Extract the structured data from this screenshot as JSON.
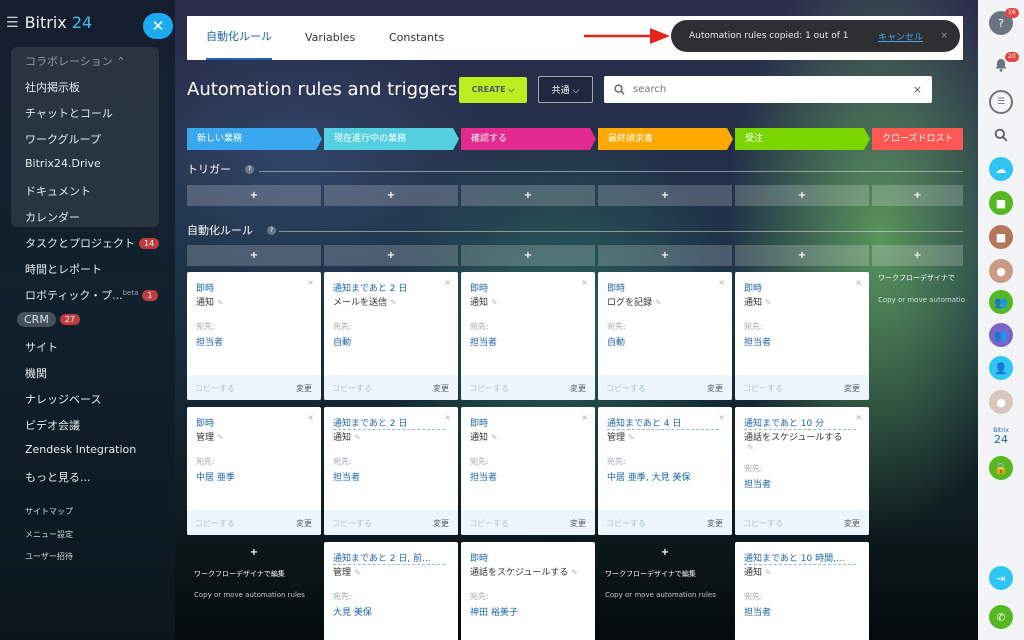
{
  "app": {
    "brand_a": "Bitrix",
    "brand_b": "24"
  },
  "left_nav": {
    "collab_header": "コラボレーション ⌃",
    "items": [
      "社内掲示板",
      "チャットとコール",
      "ワークグループ",
      "Bitrix24.Drive",
      "ドキュメント",
      "カレンダー",
      "タスクとプロジェクト",
      "時間とレポート",
      "ロボティック・プ...",
      "CRM",
      "サイト",
      "機関",
      "ナレッジベース",
      "ビデオ会議",
      "Zendesk Integration",
      "もっと見る..."
    ],
    "badges": {
      "tasks": "14",
      "robotic": "1",
      "crm": "27"
    },
    "beta": "beta",
    "footer": [
      "サイトマップ",
      "メニュー設定",
      "ユーザー招待"
    ]
  },
  "tabs": [
    "自動化ルール",
    "Variables",
    "Constants"
  ],
  "toast": {
    "message": "Automation rules copied: 1 out of 1",
    "cancel": "キャンセル",
    "close": "×"
  },
  "page_title": "Automation rules and triggers",
  "create_label": "CREATE ⌵",
  "common_label": "共通 ⌵",
  "search": {
    "placeholder": "search",
    "clear": "×"
  },
  "stages": [
    {
      "label": "新しい業務",
      "color": "#39a8ef"
    },
    {
      "label": "現在進行中の業務",
      "color": "#55d0e0"
    },
    {
      "label": "確認する",
      "color": "#e32a8e"
    },
    {
      "label": "最終請求書",
      "color": "#ffa900"
    },
    {
      "label": "受注",
      "color": "#7bd500"
    },
    {
      "label": "クローズドロスト",
      "color": "#ff5752"
    }
  ],
  "triggers_header": "トリガー",
  "rules_header": "自動化ルール",
  "help_mark": "?",
  "add_symbol": "+",
  "card_labels": {
    "recipient": "宛先:",
    "copy": "コピーする",
    "change": "変更",
    "close": "×",
    "pencil": "✎"
  },
  "cards": [
    {
      "when": "即時",
      "action": "通知",
      "recipient": "担当者"
    },
    {
      "when": "通知まであと 2 日",
      "action": "メールを送信",
      "recipient": "自動"
    },
    {
      "when": "即時",
      "action": "通知",
      "recipient": "担当者"
    },
    {
      "when": "即時",
      "action": "ログを記録",
      "recipient": "自動"
    },
    {
      "when": "即時",
      "action": "通知",
      "recipient": "担当者"
    },
    {
      "when": "即時",
      "action": "管理",
      "recipient": "中居 亜季"
    },
    {
      "when": "通知まであと 2 日",
      "action": "通知",
      "recipient": "担当者"
    },
    {
      "when": "即時",
      "action": "通知",
      "recipient": "担当者"
    },
    {
      "when": "通知まであと 4 日",
      "action": "管理",
      "recipient": "中居 亜季, 大見 美保"
    },
    {
      "when": "通知まであと 10 分",
      "action": "通話をスケジュールする",
      "recipient": "担当者"
    },
    {
      "when": "通知まであと 2 日, 前...",
      "action": "管理",
      "recipient": "大見 美保"
    },
    {
      "when": "即時",
      "action": "通話をスケジュールする",
      "recipient": "神田 裕美子"
    },
    {
      "when": "通知まであと 10 時間,...",
      "action": "通知",
      "recipient": "担当者"
    }
  ],
  "workflow": {
    "edit": "ワークフローデザイナで編集",
    "copy_move": "Copy or move automation rules",
    "edit_cut": "ワークフローデザイナで",
    "copy_move_cut": "Copy or move automatio"
  },
  "right_bar": {
    "help_badge": "16",
    "bell_badge": "20",
    "bitrix_label_a": "Bitrix",
    "bitrix_label_b": "24"
  }
}
